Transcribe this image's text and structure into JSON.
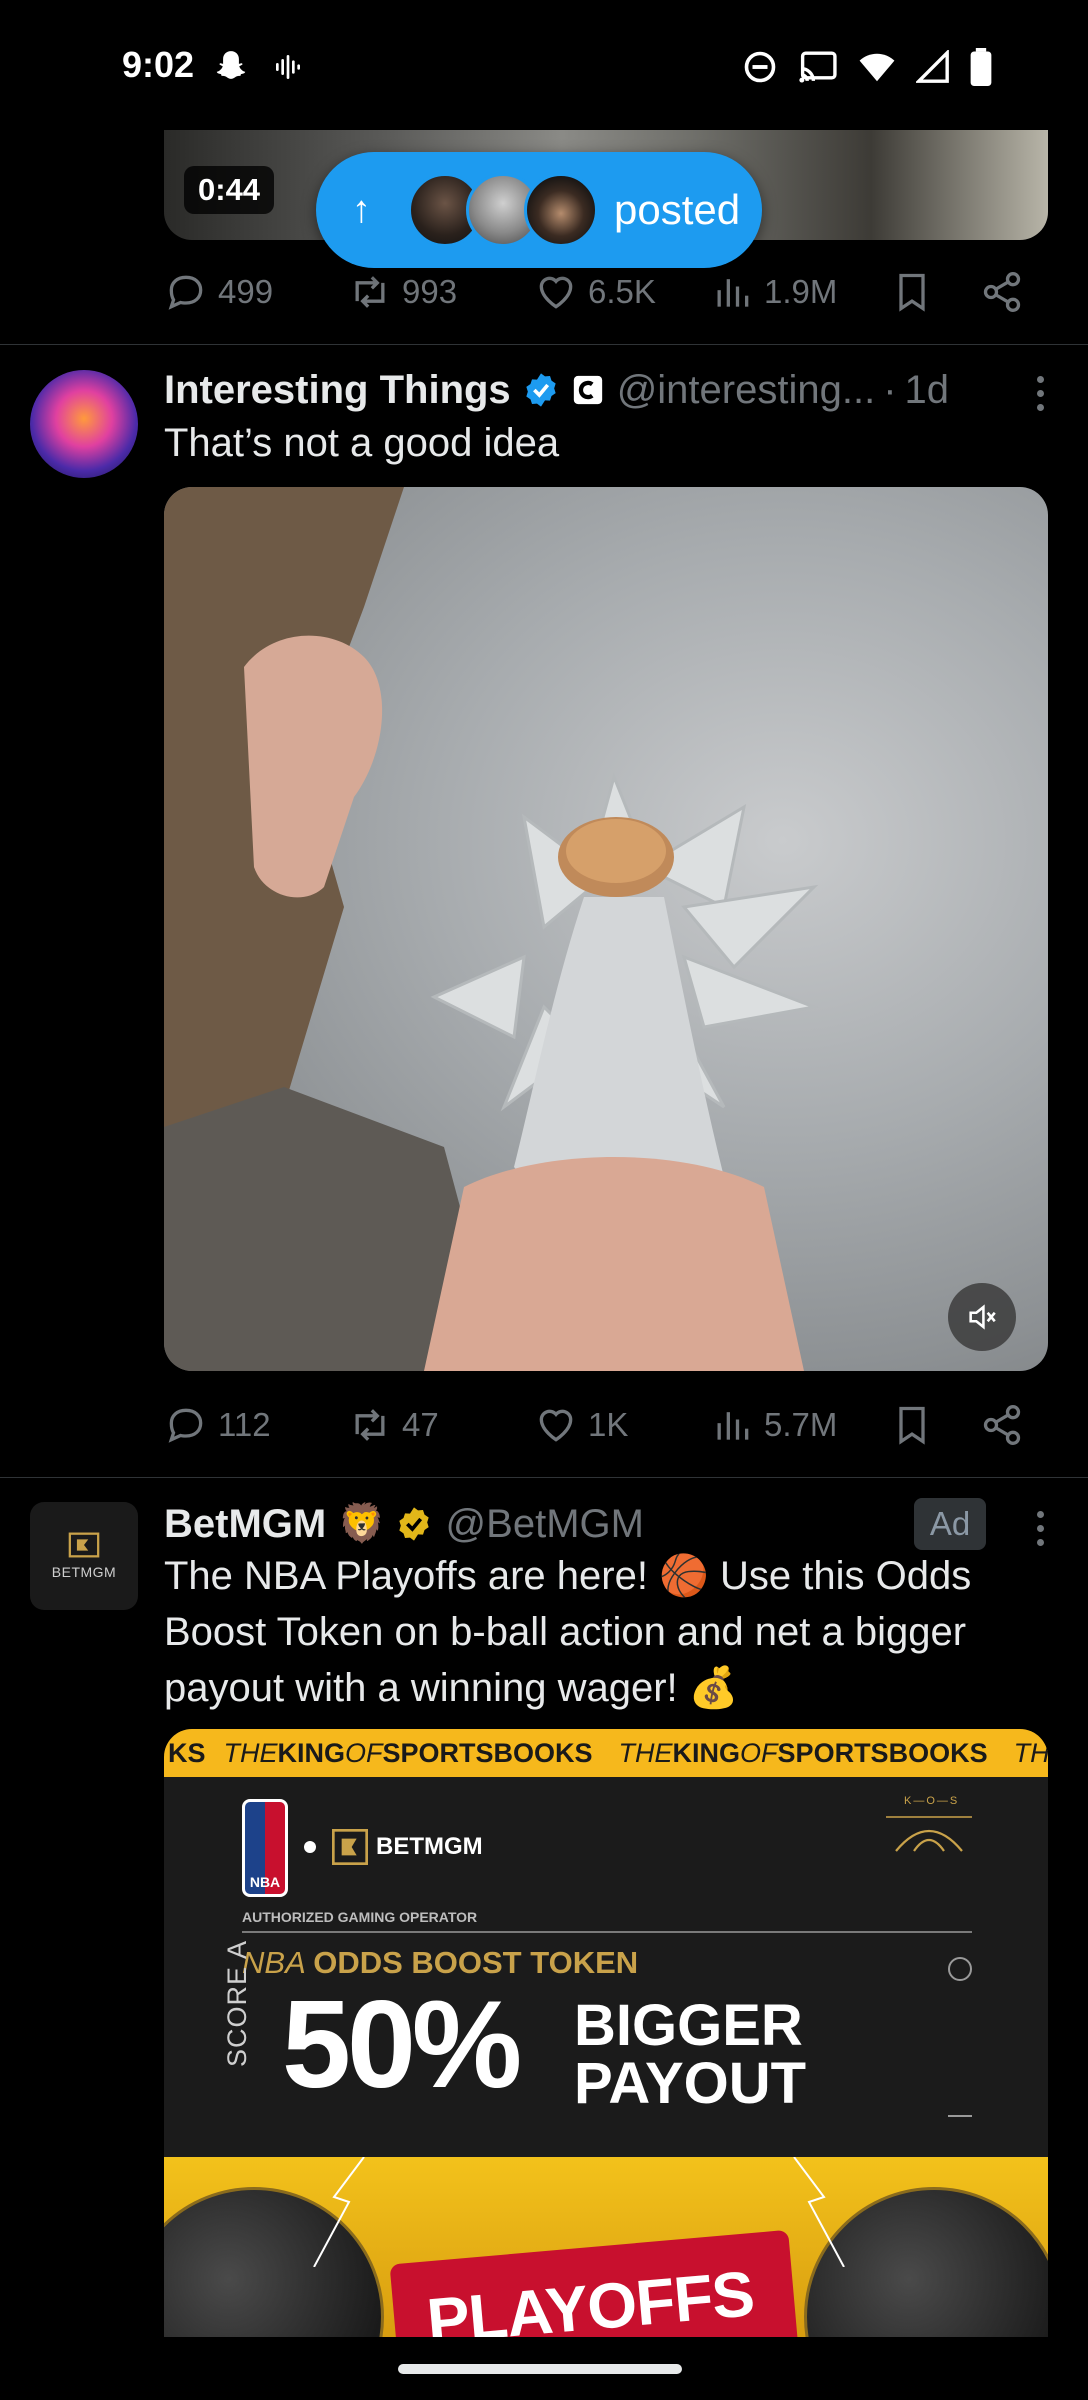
{
  "status_bar": {
    "time": "9:02"
  },
  "top_tweet": {
    "video_duration": "0:44",
    "posted_pill_label": "posted",
    "replies": "499",
    "reposts": "993",
    "likes": "6.5K",
    "views": "1.9M"
  },
  "tweet_interesting": {
    "name": "Interesting Things",
    "handle": "@interesting...",
    "time": "1d",
    "text": "That’s not a good idea",
    "replies": "112",
    "reposts": "47",
    "likes": "1K",
    "views": "5.7M"
  },
  "tweet_betmgm": {
    "name": "BetMGM",
    "handle": "@BetMGM",
    "ad_label": "Ad",
    "text": "The NBA Playoffs are here! 🏀 Use this Odds Boost Token on b-ball action and net a bigger payout with a winning wager! 💰",
    "avatar_text": "BETMGM",
    "ad_creative": {
      "ticker_1": "KS ",
      "ticker_the": "THE ",
      "ticker_king": "KING",
      "ticker_of": " OF ",
      "ticker_sportsbooks": "SPORTSBOOKS",
      "nba_label": "NBA",
      "brand_text": "BETMGM",
      "kos_label": "K—O—S",
      "authorized": "AUTHORIZED GAMING OPERATOR",
      "token_title_1": "NBA ",
      "token_title_2": "ODDS BOOST TOKEN",
      "score_a": "SCORE A",
      "percent": "50%",
      "bigger": "BIGGER",
      "payout": "PAYOUT",
      "playoffs": "PLAYOFFS"
    }
  },
  "colors": {
    "accent_blue": "#1d9bf0",
    "muted_gray": "#71767b",
    "gold": "#f6b81c",
    "nba_red": "#c8102e"
  }
}
